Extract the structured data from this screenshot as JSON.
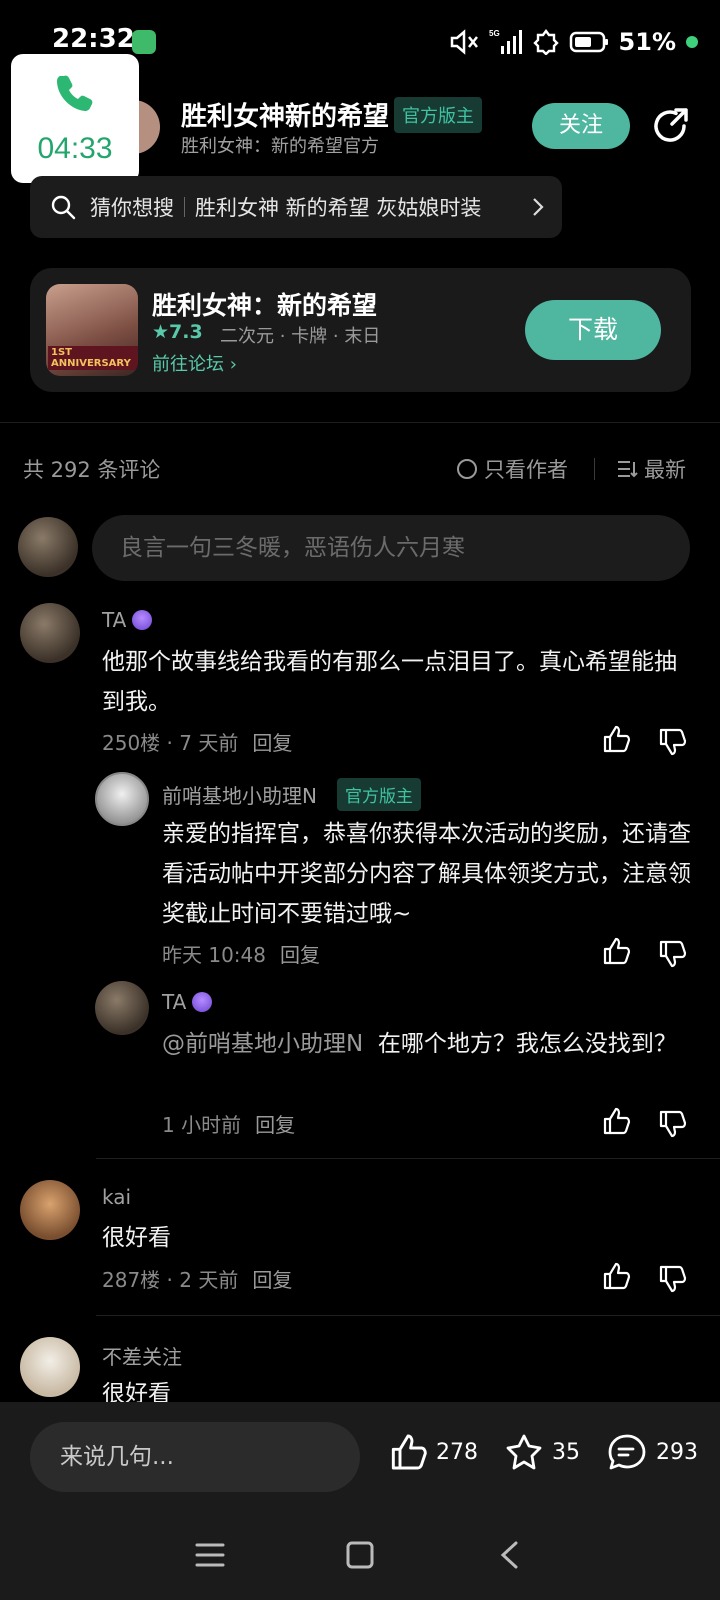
{
  "status_bar": {
    "time": "22:32",
    "network": "5G",
    "battery": "51%"
  },
  "call": {
    "duration": "04:33"
  },
  "header": {
    "title": "胜利女神新的希望",
    "badge": "官方版主",
    "subtitle": "胜利女神：新的希望官方",
    "follow_label": "关注"
  },
  "search": {
    "prefix": "猜你想搜",
    "query": "胜利女神 新的希望 灰姑娘时装"
  },
  "game_card": {
    "name": "胜利女神：新的希望",
    "rating": "7.3",
    "tags": "二次元 · 卡牌 · 末日",
    "forum_link": "前往论坛",
    "download_label": "下载",
    "icon_text": "1ST ANNIVERSARY"
  },
  "comments_header": {
    "count": "共 292 条评论",
    "only_author": "只看作者",
    "sort": "最新"
  },
  "comment_input": {
    "placeholder": "良言一句三冬暖，恶语伤人六月寒"
  },
  "comments": [
    {
      "user": "TA",
      "text": "他那个故事线给我看的有那么一点泪目了。真心希望能抽到我。",
      "floor": "250楼",
      "time": "7 天前",
      "reply": "回复",
      "replies": [
        {
          "user": "前哨基地小助理N",
          "badge": "官方版主",
          "text": "亲爱的指挥官，恭喜你获得本次活动的奖励，还请查看活动帖中开奖部分内容了解具体领奖方式，注意领奖截止时间不要错过哦~",
          "time": "昨天 10:48",
          "reply": "回复"
        },
        {
          "user": "TA",
          "mention": "@前哨基地小助理N",
          "text": "在哪个地方？我怎么没找到？",
          "time": "1 小时前",
          "reply": "回复"
        }
      ]
    },
    {
      "user": "kai",
      "text": "很好看",
      "floor": "287楼",
      "time": "2 天前",
      "reply": "回复"
    },
    {
      "user": "不差关注",
      "text": "很好看"
    }
  ],
  "bottom_bar": {
    "placeholder": "来说几句...",
    "likes": "278",
    "favorites": "35",
    "comments": "293"
  },
  "colors": {
    "accent": "#4fb6a0",
    "background": "#000000",
    "card": "#1a1a1a"
  }
}
